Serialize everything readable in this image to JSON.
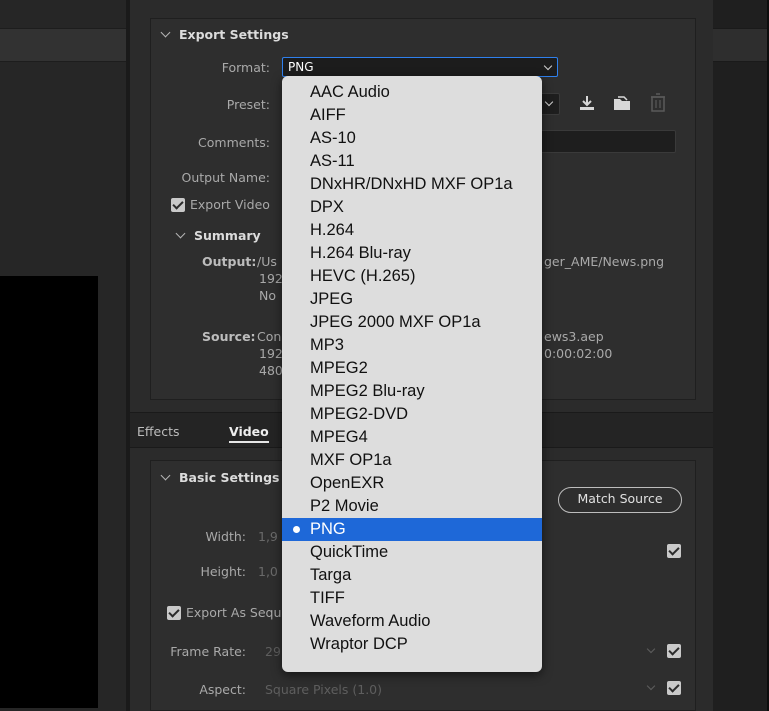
{
  "export_settings": {
    "title": "Export Settings",
    "format_label": "Format:",
    "format_value": "PNG",
    "preset_label": "Preset:",
    "comments_label": "Comments:",
    "output_name_label": "Output Name:",
    "export_video_label": "Export Video",
    "summary": {
      "title": "Summary",
      "output_label": "Output:",
      "output_line1_partial": "/Us",
      "output_line1_right": "ger_AME/News.png",
      "output_line2_partial": "192",
      "output_line3_partial": "No",
      "source_label": "Source:",
      "source_line1_partial": "Con",
      "source_line1_right": "ews3.aep",
      "source_line2_partial": "192",
      "source_line2_right": "0:00:02:00",
      "source_line3_partial": "480"
    }
  },
  "tabs": [
    {
      "label": "Effects"
    },
    {
      "label": "Video"
    }
  ],
  "basic_settings": {
    "title": "Basic Settings",
    "match_source_label": "Match Source",
    "width_label": "Width:",
    "width_value_partial": "1,9",
    "height_label": "Height:",
    "height_value_partial": "1,0",
    "export_sequence_label": "Export As Sequ",
    "frame_rate_label": "Frame Rate:",
    "frame_rate_value_partial": "29",
    "aspect_label": "Aspect:",
    "aspect_value": "Square Pixels (1.0)"
  },
  "format_dropdown": {
    "selected": "PNG",
    "options": [
      "AAC Audio",
      "AIFF",
      "AS-10",
      "AS-11",
      "DNxHR/DNxHD MXF OP1a",
      "DPX",
      "H.264",
      "H.264 Blu-ray",
      "HEVC (H.265)",
      "JPEG",
      "JPEG 2000 MXF OP1a",
      "MP3",
      "MPEG2",
      "MPEG2 Blu-ray",
      "MPEG2-DVD",
      "MPEG4",
      "MXF OP1a",
      "OpenEXR",
      "P2 Movie",
      "PNG",
      "QuickTime",
      "Targa",
      "TIFF",
      "Waveform Audio",
      "Wraptor DCP"
    ]
  },
  "icons": {
    "save_preset": "download-icon",
    "import_preset": "import-folder-icon",
    "delete_preset": "trash-icon"
  },
  "colors": {
    "selection": "#1e68d8",
    "focus_border": "#2f80ed",
    "menu_background": "#dddddd"
  }
}
